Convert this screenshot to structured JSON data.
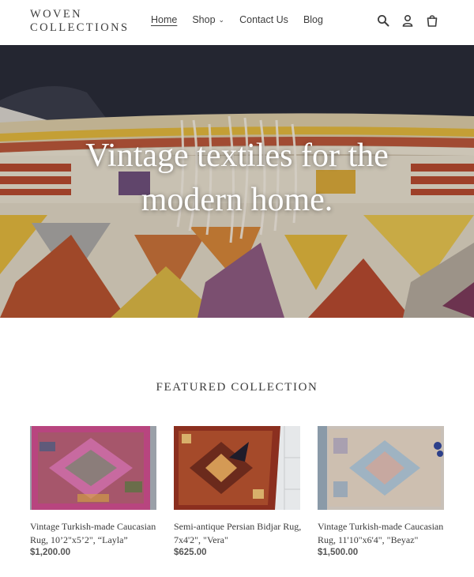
{
  "header": {
    "logo_line1": "WOVEN",
    "logo_line2": "COLLECTIONS",
    "nav": [
      {
        "label": "Home"
      },
      {
        "label": "Shop"
      },
      {
        "label": "Contact Us"
      },
      {
        "label": "Blog"
      }
    ],
    "icons": [
      "search-icon",
      "account-icon",
      "cart-icon"
    ]
  },
  "hero": {
    "line1": "Vintage textiles for the",
    "line2": "modern home."
  },
  "featured": {
    "title": "FEATURED COLLECTION",
    "products": [
      {
        "name": "Vintage Turkish-made Caucasian Rug, 10’2\"x5’2\", “Layla”",
        "price": "$1,200.00"
      },
      {
        "name": "Semi-antique Persian Bidjar Rug, 7x4'2\", \"Vera\"",
        "price": "$625.00"
      },
      {
        "name": "Vintage Turkish-made Caucasian Rug, 11'10\"x6'4\", \"Beyaz\"",
        "price": "$1,500.00"
      }
    ]
  },
  "colors": {
    "text": "#3a3a3a",
    "background": "#ffffff",
    "hero_sky": "#2a2c38"
  }
}
